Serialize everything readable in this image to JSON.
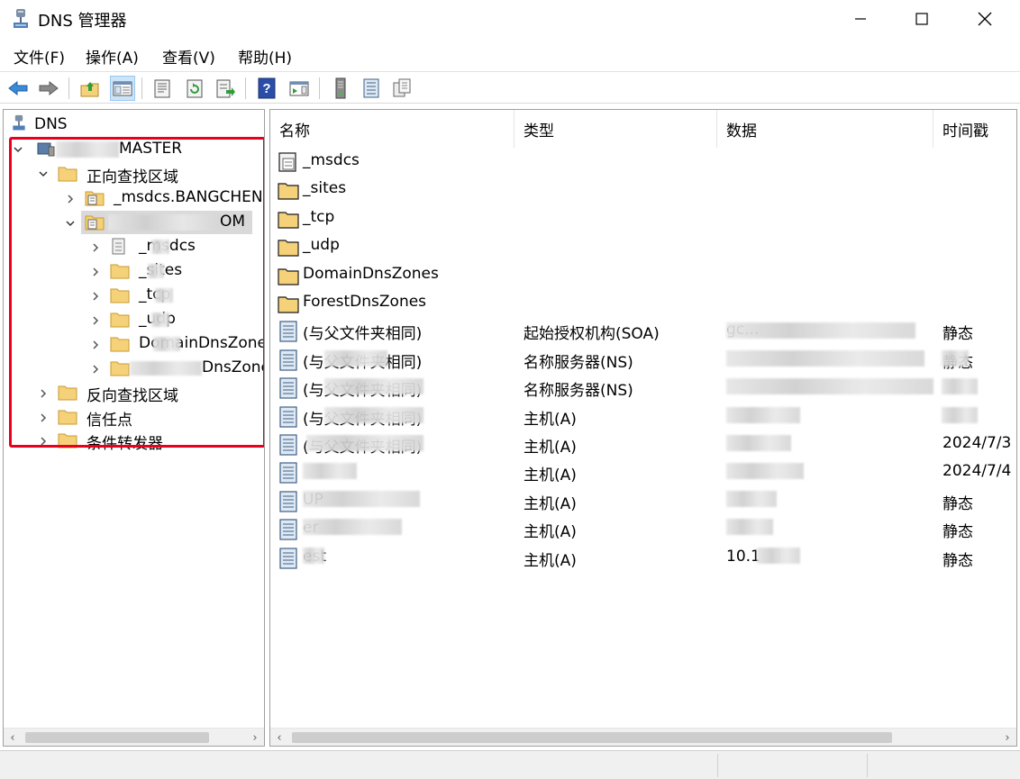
{
  "window": {
    "title": "DNS 管理器",
    "minimize_label": "最小化",
    "maximize_label": "最大化",
    "close_label": "关闭"
  },
  "menu": [
    "文件(F)",
    "操作(A)",
    "查看(V)",
    "帮助(H)"
  ],
  "toolbar": {
    "buttons": [
      "back-arrow-icon",
      "forward-arrow-icon",
      "up-folder-icon",
      "show-hide-tree-icon",
      "properties-icon",
      "refresh-icon",
      "export-list-icon",
      "help-icon",
      "show-action-pane-icon",
      "server-icon",
      "list-view-icon",
      "copy-icon"
    ]
  },
  "tree": {
    "root": "DNS",
    "server": "MASTER",
    "forward_zones": "正向查找区域",
    "msdcs_zone": "_msdcs.BANGCHEN.",
    "domain_zone": "OM",
    "sub_items": [
      "_msdcs",
      "_sites",
      "_tcp",
      "_udp",
      "DomainDnsZones",
      "DnsZones"
    ],
    "reverse_zones": "反向查找区域",
    "trust_points": "信任点",
    "conditional_forwarders": "条件转发器"
  },
  "columns": {
    "name": "名称",
    "type": "类型",
    "data": "数据",
    "timestamp": "时间戳"
  },
  "records": [
    {
      "name": "_msdcs",
      "type": "",
      "data": "",
      "timestamp": "",
      "icon": "zone-icon"
    },
    {
      "name": "_sites",
      "type": "",
      "data": "",
      "timestamp": "",
      "icon": "folder-icon"
    },
    {
      "name": "_tcp",
      "type": "",
      "data": "",
      "timestamp": "",
      "icon": "folder-icon"
    },
    {
      "name": "_udp",
      "type": "",
      "data": "",
      "timestamp": "",
      "icon": "folder-icon"
    },
    {
      "name": "DomainDnsZones",
      "type": "",
      "data": "",
      "timestamp": "",
      "icon": "folder-icon"
    },
    {
      "name": "ForestDnsZones",
      "type": "",
      "data": "",
      "timestamp": "",
      "icon": "folder-icon"
    },
    {
      "name": "(与父文件夹相同)",
      "type": "起始授权机构(SOA)",
      "data": "gc...",
      "timestamp": "静态",
      "icon": "record-icon"
    },
    {
      "name": "(与父文件夹相同)",
      "type": "名称服务器(NS)",
      "data": "",
      "timestamp": "静态",
      "icon": "record-icon"
    },
    {
      "name": "(与父文件夹相同)",
      "type": "名称服务器(NS)",
      "data": "",
      "timestamp": "",
      "icon": "record-icon"
    },
    {
      "name": "(与父文件夹相同)",
      "type": "主机(A)",
      "data": "",
      "timestamp": "",
      "icon": "record-icon"
    },
    {
      "name": "(与父文件夹相同)",
      "type": "主机(A)",
      "data": "",
      "timestamp": "2024/7/3",
      "icon": "record-icon"
    },
    {
      "name": "",
      "type": "主机(A)",
      "data": "",
      "timestamp": "2024/7/4",
      "icon": "record-icon"
    },
    {
      "name": "UP",
      "type": "主机(A)",
      "data": "",
      "timestamp": "静态",
      "icon": "record-icon"
    },
    {
      "name": "er",
      "type": "主机(A)",
      "data": "",
      "timestamp": "静态",
      "icon": "record-icon"
    },
    {
      "name": "est",
      "type": "主机(A)",
      "data": "10.1",
      "timestamp": "静态",
      "icon": "record-icon"
    }
  ],
  "colors": {
    "highlight_box": "#e8001c",
    "folder_fill": "#f5d27a",
    "folder_stroke": "#c99a2e"
  }
}
